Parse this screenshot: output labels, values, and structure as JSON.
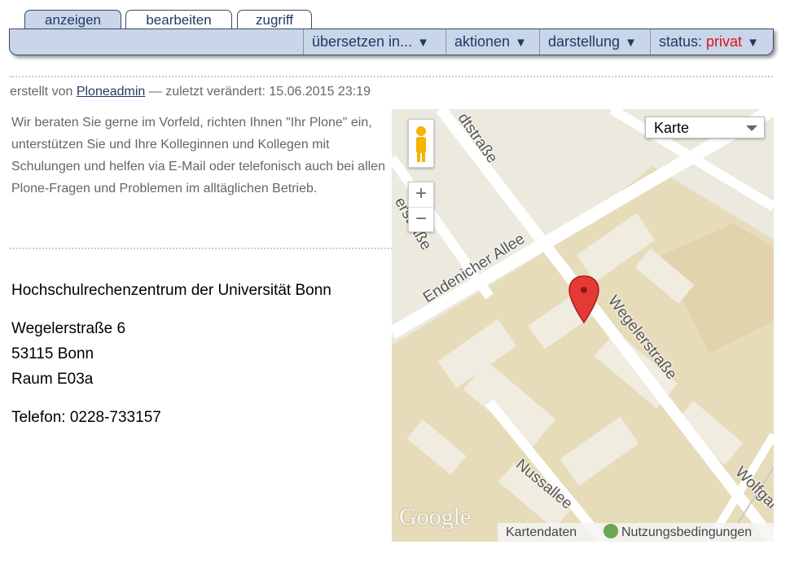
{
  "tabs": [
    "anzeigen",
    "bearbeiten",
    "zugriff"
  ],
  "menu": {
    "translate": "übersetzen in...",
    "actions": "aktionen",
    "display": "darstellung",
    "status_label": "status:",
    "status_value": "privat",
    "arrow": "▼"
  },
  "byline": {
    "prefix": "erstellt von",
    "author": "Ploneadmin",
    "modified": "— zuletzt verändert: 15.06.2015 23:19"
  },
  "description": "Wir beraten Sie gerne im Vorfeld, richten Ihnen \"Ihr Plone\" ein, unterstützen Sie und Ihre Kolleginnen und Kollegen mit Schulungen und helfen via E-Mail oder telefonisch auch bei allen Plone-Fragen und Problemen im alltäglichen Betrieb.",
  "address": {
    "org": "Hochschulrechenzentrum der Universität Bonn",
    "street": "Wegelerstraße 6",
    "city": "53115 Bonn",
    "room": "Raum E03a",
    "phone": "Telefon: 0228-733157"
  },
  "map": {
    "type_select": "Karte",
    "zoom_in": "+",
    "zoom_out": "−",
    "logo": "Google",
    "map_data": "Kartendaten",
    "terms": "Nutzungsbedingungen",
    "streets": {
      "endenicher": "Endenicher Allee",
      "wegeler": "Wegelerstraße",
      "nussallee": "Nussallee",
      "top": "dtstraße",
      "left": "erstraße",
      "wolfgang": "Wolfgar"
    }
  },
  "colors": {
    "accent": "#1f3b63",
    "bar": "#c9d6ea",
    "status_private": "#e0101a",
    "campus": "#e7dcba",
    "marker": "#e53935"
  }
}
